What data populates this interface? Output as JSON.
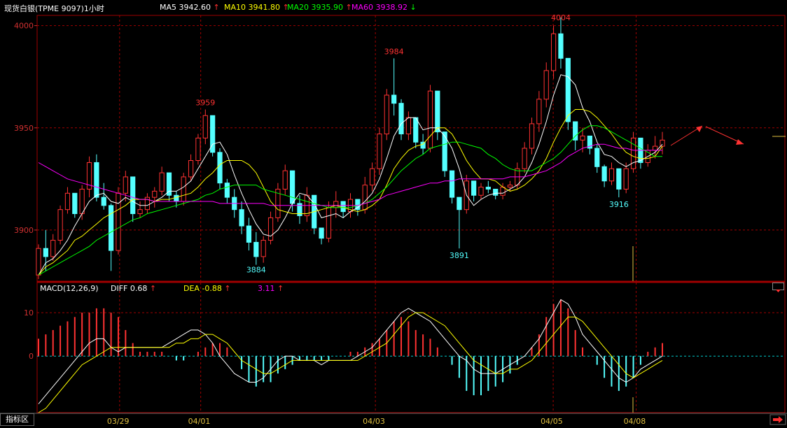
{
  "header": {
    "title": "现货白银(TPME 9097)1小时",
    "ma": [
      {
        "label": "MA5 3942.60",
        "color": "#ffffff",
        "arrow": "↑",
        "arrow_color": "#ff3030"
      },
      {
        "label": "MA10 3941.80",
        "color": "#ffff00",
        "arrow": "↑",
        "arrow_color": "#ff3030"
      },
      {
        "label": "MA20 3935.90",
        "color": "#00ff00",
        "arrow": "↑",
        "arrow_color": "#ff3030"
      },
      {
        "label": "MA60 3938.92",
        "color": "#ff00ff",
        "arrow": "↓",
        "arrow_color": "#00ff00"
      }
    ]
  },
  "macd_header": {
    "title": "MACD(12,26,9)",
    "diff": "DIFF  0.68",
    "dea": "DEA  -0.88",
    "macd": "3.11",
    "arrow": "↑"
  },
  "footer": {
    "tab": "指标区"
  },
  "colors": {
    "up": "#ff3232",
    "down": "#54ffff",
    "grid": "#a00000",
    "axis_text": "#d03030"
  },
  "chart_data": [
    {
      "type": "candlestick",
      "title": "现货白银(TPME 9097)1小时",
      "ylim": [
        3875,
        4005
      ],
      "y_ticks": [
        3900,
        3950,
        4000
      ],
      "x_ticks": [
        "03/29",
        "04/01",
        "04/03",
        "04/05",
        "04/08"
      ],
      "annotations": [
        "3959",
        "3884",
        "3984",
        "3891",
        "4004",
        "3916"
      ],
      "ohlc": [
        [
          3878,
          3893,
          3876,
          3891
        ],
        [
          3891,
          3900,
          3880,
          3887
        ],
        [
          3887,
          3898,
          3885,
          3895
        ],
        [
          3895,
          3912,
          3893,
          3910
        ],
        [
          3910,
          3921,
          3908,
          3918
        ],
        [
          3918,
          3917,
          3906,
          3908
        ],
        [
          3908,
          3922,
          3905,
          3920
        ],
        [
          3920,
          3936,
          3916,
          3933
        ],
        [
          3933,
          3937,
          3914,
          3916
        ],
        [
          3916,
          3923,
          3910,
          3912
        ],
        [
          3912,
          3913,
          3880,
          3890
        ],
        [
          3890,
          3921,
          3888,
          3918
        ],
        [
          3918,
          3929,
          3914,
          3926
        ],
        [
          3926,
          3916,
          3904,
          3908
        ],
        [
          3908,
          3914,
          3906,
          3910
        ],
        [
          3910,
          3918,
          3908,
          3916
        ],
        [
          3916,
          3921,
          3911,
          3919
        ],
        [
          3919,
          3931,
          3917,
          3928
        ],
        [
          3928,
          3922,
          3914,
          3917
        ],
        [
          3917,
          3919,
          3911,
          3914
        ],
        [
          3914,
          3928,
          3912,
          3926
        ],
        [
          3926,
          3937,
          3924,
          3934
        ],
        [
          3934,
          3947,
          3932,
          3945
        ],
        [
          3945,
          3959,
          3942,
          3956
        ],
        [
          3956,
          3954,
          3936,
          3938
        ],
        [
          3938,
          3940,
          3920,
          3923
        ],
        [
          3923,
          3925,
          3913,
          3916
        ],
        [
          3916,
          3920,
          3906,
          3910
        ],
        [
          3910,
          3914,
          3898,
          3902
        ],
        [
          3902,
          3906,
          3890,
          3894
        ],
        [
          3894,
          3899,
          3883,
          3887
        ],
        [
          3887,
          3897,
          3884,
          3895
        ],
        [
          3895,
          3909,
          3893,
          3906
        ],
        [
          3906,
          3923,
          3904,
          3920
        ],
        [
          3920,
          3932,
          3917,
          3929
        ],
        [
          3929,
          3921,
          3909,
          3913
        ],
        [
          3913,
          3917,
          3903,
          3907
        ],
        [
          3907,
          3921,
          3904,
          3917
        ],
        [
          3917,
          3910,
          3898,
          3901
        ],
        [
          3901,
          3899,
          3893,
          3896
        ],
        [
          3896,
          3914,
          3894,
          3911
        ],
        [
          3911,
          3919,
          3906,
          3914
        ],
        [
          3914,
          3912,
          3906,
          3909
        ],
        [
          3909,
          3918,
          3906,
          3915
        ],
        [
          3915,
          3913,
          3907,
          3910
        ],
        [
          3910,
          3926,
          3908,
          3922
        ],
        [
          3922,
          3933,
          3919,
          3930
        ],
        [
          3930,
          3950,
          3927,
          3947
        ],
        [
          3947,
          3969,
          3944,
          3966
        ],
        [
          3966,
          3984,
          3956,
          3962
        ],
        [
          3962,
          3964,
          3944,
          3947
        ],
        [
          3947,
          3958,
          3944,
          3955
        ],
        [
          3955,
          3950,
          3940,
          3943
        ],
        [
          3943,
          3947,
          3937,
          3940
        ],
        [
          3940,
          3971,
          3938,
          3968
        ],
        [
          3968,
          3960,
          3944,
          3948
        ],
        [
          3948,
          3938,
          3926,
          3929
        ],
        [
          3929,
          3926,
          3913,
          3916
        ],
        [
          3916,
          3914,
          3891,
          3910
        ],
        [
          3910,
          3927,
          3908,
          3924
        ],
        [
          3924,
          3924,
          3914,
          3917
        ],
        [
          3917,
          3923,
          3915,
          3921
        ],
        [
          3921,
          3924,
          3918,
          3920
        ],
        [
          3920,
          3918,
          3915,
          3917
        ],
        [
          3917,
          3923,
          3915,
          3921
        ],
        [
          3921,
          3924,
          3919,
          3922
        ],
        [
          3922,
          3933,
          3920,
          3930
        ],
        [
          3930,
          3943,
          3928,
          3940
        ],
        [
          3940,
          3955,
          3937,
          3952
        ],
        [
          3952,
          3968,
          3948,
          3964
        ],
        [
          3964,
          3982,
          3960,
          3978
        ],
        [
          3978,
          4000,
          3974,
          3996
        ],
        [
          3996,
          4004,
          3979,
          3984
        ],
        [
          3984,
          3971,
          3949,
          3953
        ],
        [
          3953,
          3951,
          3939,
          3944
        ],
        [
          3944,
          3950,
          3938,
          3946
        ],
        [
          3946,
          3945,
          3937,
          3940
        ],
        [
          3940,
          3942,
          3928,
          3931
        ],
        [
          3931,
          3932,
          3921,
          3924
        ],
        [
          3924,
          3933,
          3922,
          3930
        ],
        [
          3930,
          3929,
          3916,
          3920
        ],
        [
          3920,
          3933,
          3918,
          3930
        ],
        [
          3930,
          3948,
          3928,
          3945
        ],
        [
          3945,
          3944,
          3930,
          3933
        ],
        [
          3933,
          3942,
          3931,
          3939
        ],
        [
          3939,
          3946,
          3935,
          3941
        ],
        [
          3941,
          3948,
          3937,
          3944
        ]
      ],
      "series": [
        {
          "name": "MA5",
          "color": "#ffffff",
          "values": [
            3878,
            3884,
            3886,
            3890,
            3895,
            3902,
            3908,
            3914,
            3917,
            3918,
            3914,
            3913,
            3916,
            3914,
            3912,
            3912,
            3914,
            3916,
            3919,
            3919,
            3921,
            3924,
            3930,
            3936,
            3942,
            3943,
            3937,
            3927,
            3918,
            3910,
            3903,
            3898,
            3897,
            3900,
            3906,
            3913,
            3918,
            3917,
            3913,
            3906,
            3907,
            3908,
            3906,
            3909,
            3911,
            3914,
            3918,
            3925,
            3935,
            3946,
            3952,
            3955,
            3955,
            3949,
            3950,
            3950,
            3946,
            3940,
            3930,
            3917,
            3912,
            3915,
            3917,
            3918,
            3918,
            3920,
            3922,
            3926,
            3933,
            3942,
            3953,
            3966,
            3976,
            3975,
            3971,
            3960,
            3953,
            3943,
            3937,
            3936,
            3933,
            3931,
            3933,
            3934,
            3936,
            3938,
            3942
          ]
        },
        {
          "name": "MA10",
          "color": "#ffff00",
          "values": [
            3878,
            3882,
            3884,
            3887,
            3890,
            3895,
            3897,
            3900,
            3903,
            3906,
            3908,
            3910,
            3912,
            3915,
            3915,
            3915,
            3914,
            3915,
            3915,
            3916,
            3917,
            3918,
            3921,
            3925,
            3928,
            3932,
            3934,
            3934,
            3934,
            3932,
            3928,
            3921,
            3914,
            3910,
            3909,
            3908,
            3908,
            3908,
            3909,
            3910,
            3911,
            3912,
            3911,
            3910,
            3909,
            3910,
            3912,
            3915,
            3922,
            3930,
            3935,
            3939,
            3941,
            3942,
            3946,
            3950,
            3950,
            3947,
            3941,
            3934,
            3929,
            3925,
            3925,
            3924,
            3921,
            3919,
            3920,
            3922,
            3925,
            3929,
            3935,
            3943,
            3950,
            3956,
            3959,
            3959,
            3958,
            3955,
            3951,
            3947,
            3942,
            3938,
            3936,
            3935,
            3935,
            3936,
            3941
          ]
        },
        {
          "name": "MA20",
          "color": "#00ff00",
          "values": [
            3878,
            3880,
            3882,
            3884,
            3886,
            3888,
            3890,
            3892,
            3895,
            3897,
            3899,
            3901,
            3903,
            3905,
            3906,
            3908,
            3909,
            3910,
            3911,
            3912,
            3913,
            3914,
            3915,
            3917,
            3918,
            3920,
            3921,
            3922,
            3922,
            3922,
            3922,
            3920,
            3919,
            3918,
            3917,
            3916,
            3915,
            3914,
            3913,
            3912,
            3911,
            3911,
            3911,
            3911,
            3912,
            3913,
            3915,
            3918,
            3921,
            3925,
            3929,
            3932,
            3935,
            3937,
            3940,
            3941,
            3942,
            3943,
            3943,
            3942,
            3941,
            3940,
            3937,
            3935,
            3932,
            3930,
            3929,
            3929,
            3929,
            3931,
            3933,
            3935,
            3938,
            3942,
            3946,
            3949,
            3951,
            3951,
            3950,
            3948,
            3946,
            3944,
            3942,
            3940,
            3938,
            3936,
            3936
          ]
        },
        {
          "name": "MA60",
          "color": "#ff00ff",
          "values": [
            3933,
            3931,
            3929,
            3927,
            3925,
            3924,
            3923,
            3922,
            3921,
            3920,
            3919,
            3918,
            3917,
            3916,
            3915,
            3915,
            3914,
            3914,
            3914,
            3914,
            3914,
            3914,
            3914,
            3914,
            3914,
            3913,
            3913,
            3913,
            3913,
            3913,
            3913,
            3913,
            3912,
            3912,
            3912,
            3912,
            3912,
            3912,
            3912,
            3912,
            3912,
            3912,
            3912,
            3912,
            3912,
            3913,
            3914,
            3915,
            3917,
            3918,
            3919,
            3920,
            3921,
            3922,
            3923,
            3923,
            3924,
            3924,
            3925,
            3925,
            3925,
            3925,
            3925,
            3925,
            3925,
            3926,
            3926,
            3926,
            3927,
            3928,
            3929,
            3931,
            3933,
            3936,
            3938,
            3940,
            3941,
            3942,
            3942,
            3941,
            3940,
            3940,
            3939,
            3939,
            3939,
            3939,
            3939
          ]
        }
      ]
    },
    {
      "type": "bar",
      "title": "MACD(12,26,9)",
      "ylim": [
        -13,
        15
      ],
      "y_ticks": [
        0,
        10
      ],
      "series": [
        {
          "name": "MACD",
          "values": [
            4,
            5,
            6,
            7,
            8,
            9,
            10,
            10,
            11,
            11,
            10,
            9,
            6,
            3,
            1,
            1,
            1,
            1,
            0,
            -1,
            -1,
            0,
            1,
            2,
            3,
            3,
            2,
            0,
            -3,
            -6,
            -7,
            -6,
            -6,
            -4,
            -3,
            -2,
            -1,
            -1,
            -1,
            -1,
            -1,
            0,
            0,
            1,
            1,
            2,
            3,
            4,
            6,
            8,
            9,
            8,
            6,
            5,
            4,
            2,
            0,
            -2,
            -5,
            -8,
            -9,
            -9,
            -8,
            -7,
            -6,
            -4,
            -2,
            0,
            2,
            5,
            9,
            12,
            13,
            11,
            6,
            2,
            0,
            -2,
            -5,
            -7,
            -8,
            -7,
            -5,
            -2,
            1,
            2,
            3
          ]
        },
        {
          "name": "DIFF",
          "color": "#ffffff",
          "values": [
            -11,
            -9,
            -7,
            -5,
            -3,
            -1,
            1,
            3,
            4,
            4,
            2,
            1,
            2,
            2,
            2,
            2,
            2,
            2,
            3,
            4,
            5,
            6,
            6,
            5,
            3,
            0,
            -2,
            -4,
            -5,
            -6,
            -6,
            -5,
            -3,
            -1,
            0,
            0,
            -1,
            -1,
            -1,
            -2,
            -1,
            -1,
            -1,
            -1,
            0,
            1,
            2,
            4,
            6,
            8,
            10,
            11,
            10,
            9,
            8,
            6,
            4,
            2,
            0,
            -1,
            -3,
            -4,
            -4,
            -4,
            -3,
            -2,
            -1,
            0,
            2,
            4,
            7,
            10,
            13,
            12,
            9,
            5,
            3,
            1,
            -1,
            -3,
            -5,
            -6,
            -5,
            -3,
            -2,
            -1,
            0
          ]
        },
        {
          "name": "DEA",
          "color": "#ffff00",
          "values": [
            -13,
            -12,
            -10,
            -8,
            -6,
            -4,
            -2,
            -1,
            0,
            1,
            2,
            2,
            2,
            2,
            2,
            2,
            2,
            2,
            2,
            3,
            3,
            4,
            4,
            5,
            5,
            4,
            3,
            1,
            -1,
            -2,
            -3,
            -4,
            -4,
            -3,
            -2,
            -1,
            -1,
            -1,
            -1,
            -1,
            -1,
            -1,
            -1,
            -1,
            -1,
            0,
            1,
            2,
            3,
            5,
            7,
            9,
            10,
            10,
            9,
            8,
            7,
            5,
            3,
            1,
            -1,
            -2,
            -3,
            -4,
            -4,
            -3,
            -3,
            -2,
            -1,
            1,
            3,
            5,
            7,
            9,
            9,
            8,
            6,
            4,
            2,
            0,
            -2,
            -4,
            -5,
            -4,
            -3,
            -2,
            -1
          ]
        }
      ]
    }
  ]
}
